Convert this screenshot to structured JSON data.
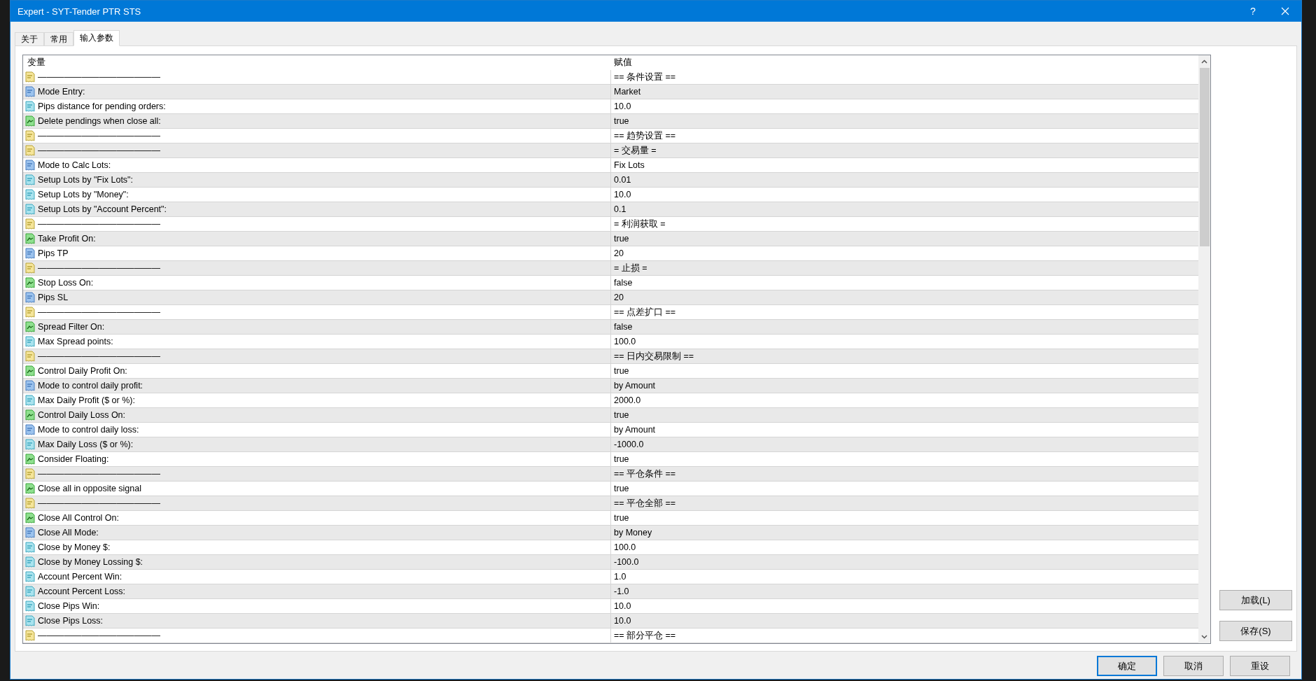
{
  "window": {
    "title": "Expert - SYT-Tender PTR STS",
    "help": "?"
  },
  "tabs": [
    {
      "label": "关于",
      "selected": false
    },
    {
      "label": "常用",
      "selected": false
    },
    {
      "label": "输入参数",
      "selected": true
    }
  ],
  "table": {
    "columns": [
      "变量",
      "赋值"
    ],
    "rows": [
      {
        "kind": "string",
        "name": "——————————————",
        "value": "== 条件设置 =="
      },
      {
        "kind": "enum",
        "name": "Mode Entry:",
        "value": "Market"
      },
      {
        "kind": "double",
        "name": "Pips distance for pending orders:",
        "value": "10.0"
      },
      {
        "kind": "bool",
        "name": "Delete pendings when close all:",
        "value": "true"
      },
      {
        "kind": "string",
        "name": "——————————————",
        "value": "== 趋势设置 =="
      },
      {
        "kind": "string",
        "name": "——————————————",
        "value": "= 交易量 ="
      },
      {
        "kind": "enum",
        "name": "Mode to Calc Lots:",
        "value": "Fix Lots"
      },
      {
        "kind": "double",
        "name": "Setup Lots by \"Fix Lots\":",
        "value": "0.01"
      },
      {
        "kind": "double",
        "name": "Setup Lots by \"Money\":",
        "value": "10.0"
      },
      {
        "kind": "double",
        "name": "Setup Lots by \"Account Percent\":",
        "value": "0.1"
      },
      {
        "kind": "string",
        "name": "——————————————",
        "value": "= 利润获取 ="
      },
      {
        "kind": "bool",
        "name": "Take Profit On:",
        "value": "true"
      },
      {
        "kind": "enum",
        "name": "Pips TP",
        "value": "20"
      },
      {
        "kind": "string",
        "name": "——————————————",
        "value": "= 止损 ="
      },
      {
        "kind": "bool",
        "name": "Stop Loss On:",
        "value": "false"
      },
      {
        "kind": "enum",
        "name": "Pips SL",
        "value": "20"
      },
      {
        "kind": "string",
        "name": "——————————————",
        "value": "== 点差扩口 =="
      },
      {
        "kind": "bool",
        "name": "Spread Filter On:",
        "value": "false"
      },
      {
        "kind": "double",
        "name": "Max Spread points:",
        "value": "100.0"
      },
      {
        "kind": "string",
        "name": "——————————————",
        "value": "== 日内交易限制 =="
      },
      {
        "kind": "bool",
        "name": "Control Daily Profit On:",
        "value": "true"
      },
      {
        "kind": "enum",
        "name": "Mode to control daily profit:",
        "value": "by Amount"
      },
      {
        "kind": "double",
        "name": "Max Daily Profit ($ or %):",
        "value": "2000.0"
      },
      {
        "kind": "bool",
        "name": "Control Daily Loss On:",
        "value": "true"
      },
      {
        "kind": "enum",
        "name": "Mode to control daily loss:",
        "value": "by Amount"
      },
      {
        "kind": "double",
        "name": "Max Daily Loss ($ or %):",
        "value": "-1000.0"
      },
      {
        "kind": "bool",
        "name": "Consider Floating:",
        "value": "true"
      },
      {
        "kind": "string",
        "name": "——————————————",
        "value": "== 平仓条件 =="
      },
      {
        "kind": "bool",
        "name": "Close all in opposite signal",
        "value": "true"
      },
      {
        "kind": "string",
        "name": "——————————————",
        "value": "== 平仓全部 =="
      },
      {
        "kind": "bool",
        "name": "Close All Control On:",
        "value": "true"
      },
      {
        "kind": "enum",
        "name": "Close All Mode:",
        "value": "by Money"
      },
      {
        "kind": "double",
        "name": "Close by Money $:",
        "value": "100.0"
      },
      {
        "kind": "double",
        "name": "Close by Money Lossing $:",
        "value": "-100.0"
      },
      {
        "kind": "double",
        "name": "Account Percent Win:",
        "value": "1.0"
      },
      {
        "kind": "double",
        "name": "Account Percent Loss:",
        "value": "-1.0"
      },
      {
        "kind": "double",
        "name": "Close Pips Win:",
        "value": "10.0"
      },
      {
        "kind": "double",
        "name": "Close Pips Loss:",
        "value": "10.0"
      },
      {
        "kind": "string",
        "name": "——————————————",
        "value": "== 部分平仓 =="
      }
    ]
  },
  "side_buttons": [
    {
      "label": "加载(L)"
    },
    {
      "label": "保存(S)"
    }
  ],
  "buttons": [
    {
      "label": "确定",
      "focused": true
    },
    {
      "label": "取消",
      "focused": false
    },
    {
      "label": "重设",
      "focused": false
    }
  ]
}
